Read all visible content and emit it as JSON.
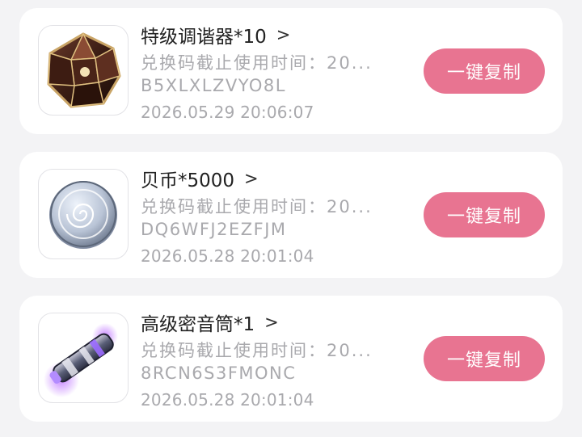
{
  "items": [
    {
      "title": "特级调谐器*10",
      "chevron": ">",
      "expiry": "兑换码截止使用时间：20...",
      "code": "B5XLXLZVYO8L",
      "time": "2026.05.29 20:06:07",
      "button": "一键复制",
      "icon": "gem-icon"
    },
    {
      "title": "贝币*5000",
      "chevron": ">",
      "expiry": "兑换码截止使用时间：20...",
      "code": "DQ6WFJ2EZFJM",
      "time": "2026.05.28 20:01:04",
      "button": "一键复制",
      "icon": "coin-icon"
    },
    {
      "title": "高级密音筒*1",
      "chevron": ">",
      "expiry": "兑换码截止使用时间：20...",
      "code": "8RCN6S3FMONC",
      "time": "2026.05.28 20:01:04",
      "button": "一键复制",
      "icon": "cylinder-icon"
    }
  ],
  "colors": {
    "background": "#f3f3f5",
    "card": "#ffffff",
    "button": "#e87491",
    "muted_text": "#a9a9ad",
    "title_text": "#222222"
  }
}
